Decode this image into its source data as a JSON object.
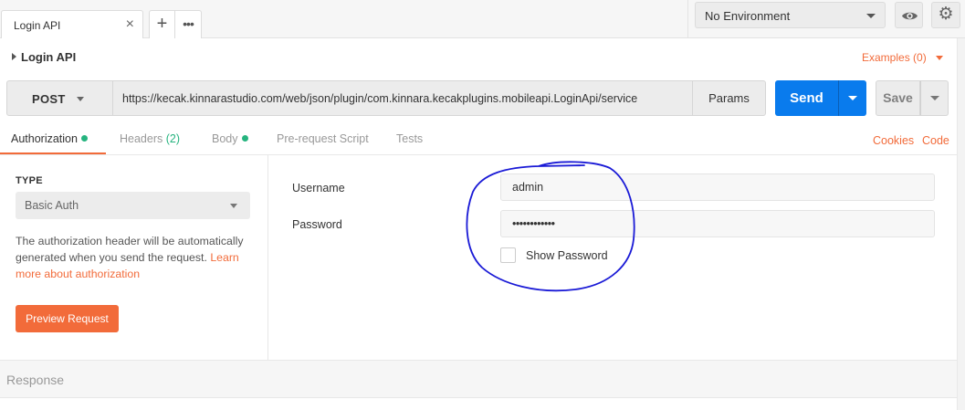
{
  "tabs": {
    "active_label": "Login API",
    "close_glyph": "×",
    "add_glyph": "+",
    "more_glyph": "•••"
  },
  "environment": {
    "selected": "No Environment"
  },
  "settings": {
    "gear_glyph": "⚙"
  },
  "request": {
    "name": "Login API",
    "examples_label": "Examples (0)",
    "method": "POST",
    "url": "https://kecak.kinnarastudio.com/web/json/plugin/com.kinnara.kecakplugins.mobileapi.LoginApi/service",
    "params_label": "Params",
    "send_label": "Send",
    "save_label": "Save"
  },
  "subtabs": {
    "authorization": "Authorization",
    "headers": "Headers",
    "headers_count": "(2)",
    "body": "Body",
    "prerequest": "Pre-request Script",
    "tests": "Tests",
    "cookies": "Cookies",
    "code": "Code"
  },
  "auth": {
    "type_label": "TYPE",
    "type_selected": "Basic Auth",
    "description": "The authorization header will be automatically generated when you send the request. ",
    "learn_more": "Learn more about authorization",
    "preview_label": "Preview Request",
    "username_label": "Username",
    "username_value": "admin",
    "password_label": "Password",
    "password_value": "••••••••••••",
    "show_password_label": "Show Password"
  },
  "response": {
    "label": "Response"
  },
  "colors": {
    "accent": "#f26b3a",
    "send_blue": "#097bed",
    "status_green": "#26b47f",
    "annotation_blue": "#1a1ad6"
  }
}
